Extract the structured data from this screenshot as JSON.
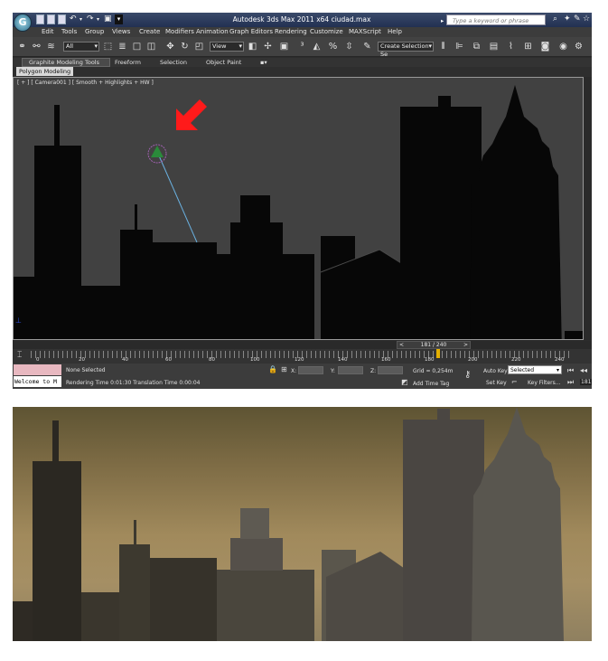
{
  "window": {
    "title": "Autodesk 3ds Max  2011 x64     ciudad.max",
    "app_button_glyph": "G",
    "search_placeholder": "Type a keyword or phrase"
  },
  "menu": [
    "Edit",
    "Tools",
    "Group",
    "Views",
    "Create",
    "Modifiers",
    "Animation",
    "Graph Editors",
    "Rendering",
    "Customize",
    "MAXScript",
    "Help"
  ],
  "toolbar": {
    "selection_filter": "All",
    "reference_coord": "View",
    "named_selection": "Create Selection Se"
  },
  "ribbon": {
    "tabs": [
      "Graphite Modeling Tools",
      "Freeform",
      "Selection",
      "Object Paint"
    ],
    "active_subtab": "Polygon Modeling"
  },
  "viewport": {
    "label": "[ + ] [ Camera001 ] [ Smooth + Highlights + HW ]"
  },
  "timeline": {
    "frame_display": "181 / 240",
    "prev": "<",
    "next": ">",
    "current_frame": 181,
    "total_frames": 240,
    "ticks": [
      "0",
      "20",
      "40",
      "60",
      "80",
      "100",
      "120",
      "140",
      "160",
      "180",
      "200",
      "220",
      "240"
    ]
  },
  "status": {
    "maxscript_text": "Welcome to M",
    "selection_status": "None Selected",
    "render_info": "Rendering Time  0:01:30    Translation Time  0:00:04",
    "x_label": "X:",
    "y_label": "Y:",
    "z_label": "Z:",
    "grid": "Grid = 0,254m",
    "add_time_tag": "Add Time Tag",
    "auto_key": "Auto Key",
    "set_key": "Set Key",
    "key_mode": "Selected",
    "key_filters": "Key Filters...",
    "frame_field": "181"
  },
  "colors": {
    "viewport_bg": "#414141",
    "arrow": "#ff1a1a",
    "time_marker": "#e4b000",
    "target_line": "#6ab0e0"
  }
}
